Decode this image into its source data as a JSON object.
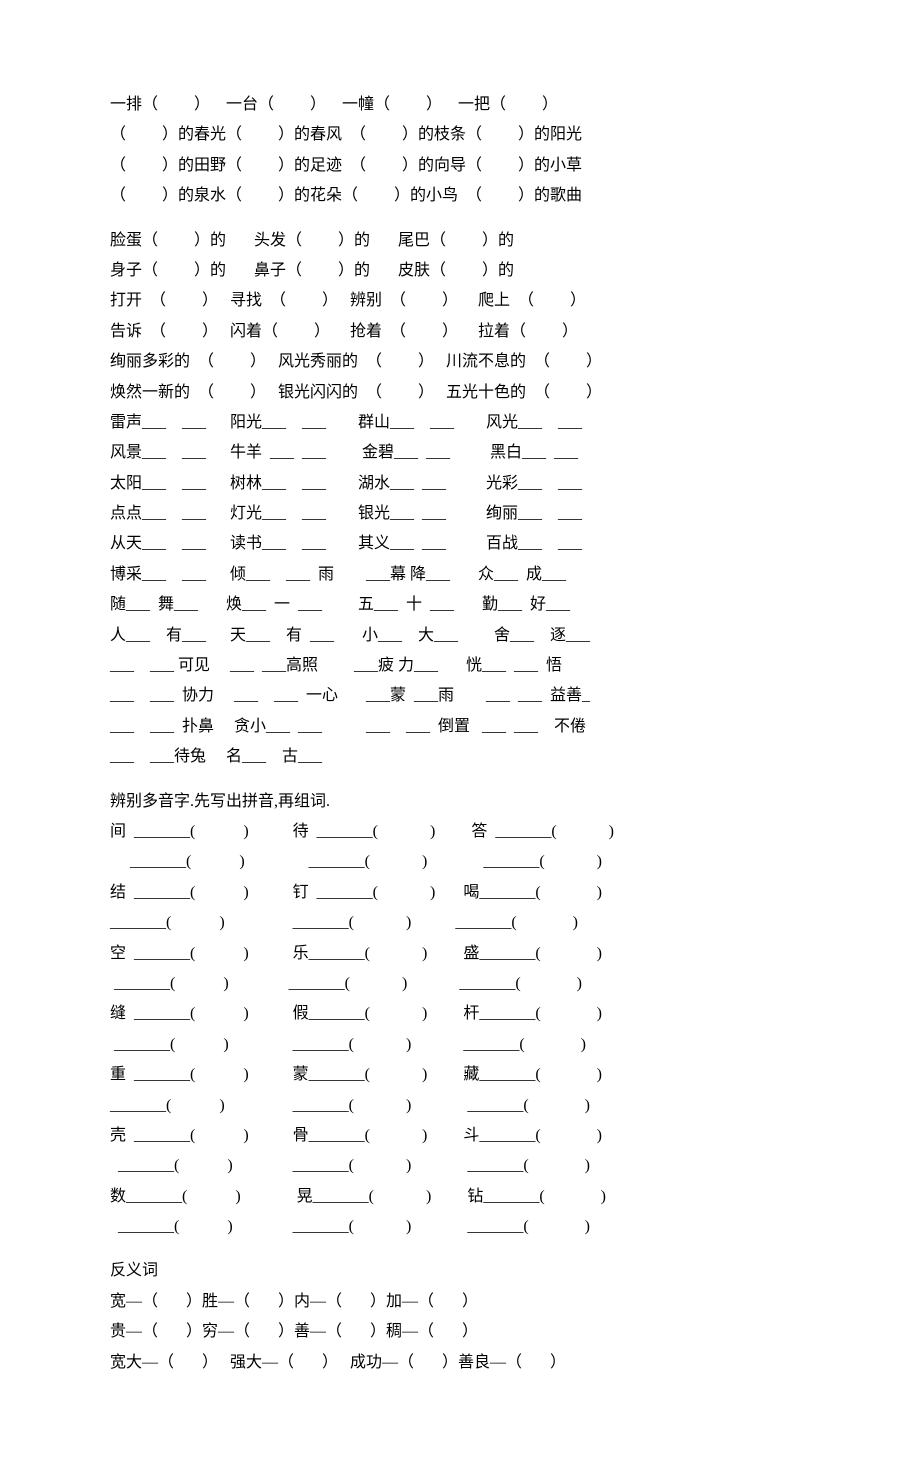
{
  "lines": {
    "l1": "一排（         ）    一台（         ）    一幢（         ）    一把（         ）",
    "l2": "（         ）的春光（         ）的春风  （         ）的枝条（         ）的阳光",
    "l3": "（         ）的田野（         ）的足迹  （         ）的向导（         ）的小草",
    "l4": "（         ）的泉水（         ）的花朵（         ）的小鸟  （         ）的歌曲",
    "l5": "脸蛋（         ）的       头发（         ）的       尾巴（         ）的",
    "l6": "身子（         ）的       鼻子（         ）的       皮肤（         ）的",
    "l7": "打开  （         ）   寻找  （         ）   辨别  （         ）     爬上  （         ）",
    "l8": "告诉  （         ）   闪着（         ）     抢着  （         ）     拉着（         ）",
    "l9": "绚丽多彩的  （         ）   风光秀丽的  （         ）   川流不息的  （         ）",
    "l10": "焕然一新的  （         ）   银光闪闪的  （         ）   五光十色的  （         ）",
    "l11": "雷声___    ___      阳光___    ___        群山___    ___        风光___    ___",
    "l12": "风景___    ___      牛羊  ___  ___         金碧___  ___          黑白___  ___",
    "l13": "太阳___    ___      树林___    ___        湖水___  ___          光彩___    ___",
    "l14": "点点___    ___      灯光___    ___        银光___  ___          绚丽___    ___",
    "l15": "从天___    ___      读书___    ___        其义___  ___          百战___    ___",
    "l16": "博采___    ___      倾___    ___  雨        ___幕 降___       众___  成___",
    "l17": "随___  舞___       焕___  一  ___         五___  十  ___       勤___  好___",
    "l18": "人___    有___      天___    有  ___       小___    大___         舍___    逐___",
    "l19": "___    ___ 可见     ___  ___高照         ___疲 力___       恍___  ___  悟",
    "l20": "___    ___  协力     ___    ___  一心       ___蒙  ___雨        ___  ___  益善_",
    "l21": "___    ___  扑鼻     贪小___  ___           ___    ___  倒置   ___  ___    不倦",
    "l22": "___    ___待兔     名___    古___",
    "l23": "辨别多音字.先写出拼音,再组词.",
    "l24": "间  _______(            )           待  _______(             )         答  _______(             )",
    "l25": "     _______(            )                _______(             )              _______(             )",
    "l26": "结  _______(            )           钉  _______(             )       喝_______(              )",
    "l27": "_______(            )                 _______(             )           _______(              )",
    "l28": "空  _______(            )           乐_______(             )         盛_______(              )",
    "l29": " _______(            )               _______(             )             _______(              )",
    "l30": "缝  _______(            )           假_______(             )         杆_______(              )",
    "l31": " _______(            )                _______(             )             _______(              )",
    "l32": "重  _______(            )           蒙_______(             )         藏_______(              )",
    "l33": "_______(            )                 _______(             )              _______(              )",
    "l34": "壳  _______(            )           骨_______(             )         斗_______(              )",
    "l35": "  _______(            )               _______(             )              _______(              )",
    "l36": "数_______(            )              晃_______(             )         钻_______(              )",
    "l37": "  _______(            )               _______(             )              _______(              )",
    "l38": "反义词",
    "l39": "宽—（       ）胜—（       ）内—（       ）加—（       ）",
    "l40": "贵—（       ）穷—（       ）善—（       ）稠—（       ）",
    "l41": "宽大—（       ）   强大—（       ）   成功—（       ）善良—（       ）"
  }
}
